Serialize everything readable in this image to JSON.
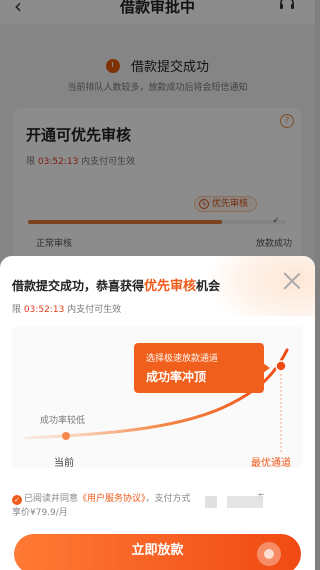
{
  "nav": {
    "back_icon": "back-arrow-icon",
    "title": "借款审批中",
    "support_icon": "headset-icon"
  },
  "status": {
    "title": "借款提交成功",
    "subtitle": "当前排队人数较多，放款成功后将会短信通知"
  },
  "card": {
    "title": "开通可优先审核",
    "timer_prefix": "限 ",
    "timer": "03:52:13",
    "timer_suffix": " 内支付可生效",
    "priority_badge": "优先审核",
    "label_normal": "正常审核",
    "label_done": "放款成功",
    "progress": 0.75
  },
  "sheet": {
    "title_prefix": "借款提交成功，恭喜获得",
    "title_highlight": "优先审核",
    "title_suffix": "机会",
    "timer_prefix": "限 ",
    "timer": "03:52:13",
    "timer_suffix": " 内支付可生效",
    "tip_line1": "选择极速放款通道",
    "tip_line2": "成功率冲顶",
    "low_label": "成功率较低",
    "x_now": "当前",
    "x_best": "最优通道",
    "agree_prefix": "已阅读并同意",
    "agree_link": "《用户服务协议》",
    "agree_mid": "，支付方式",
    "agree_tail": "专",
    "agree_line2": "享价¥79.9/月",
    "cta": "立即放款"
  },
  "colors": {
    "accent": "#f05a1a",
    "timer": "#e03a1e"
  }
}
